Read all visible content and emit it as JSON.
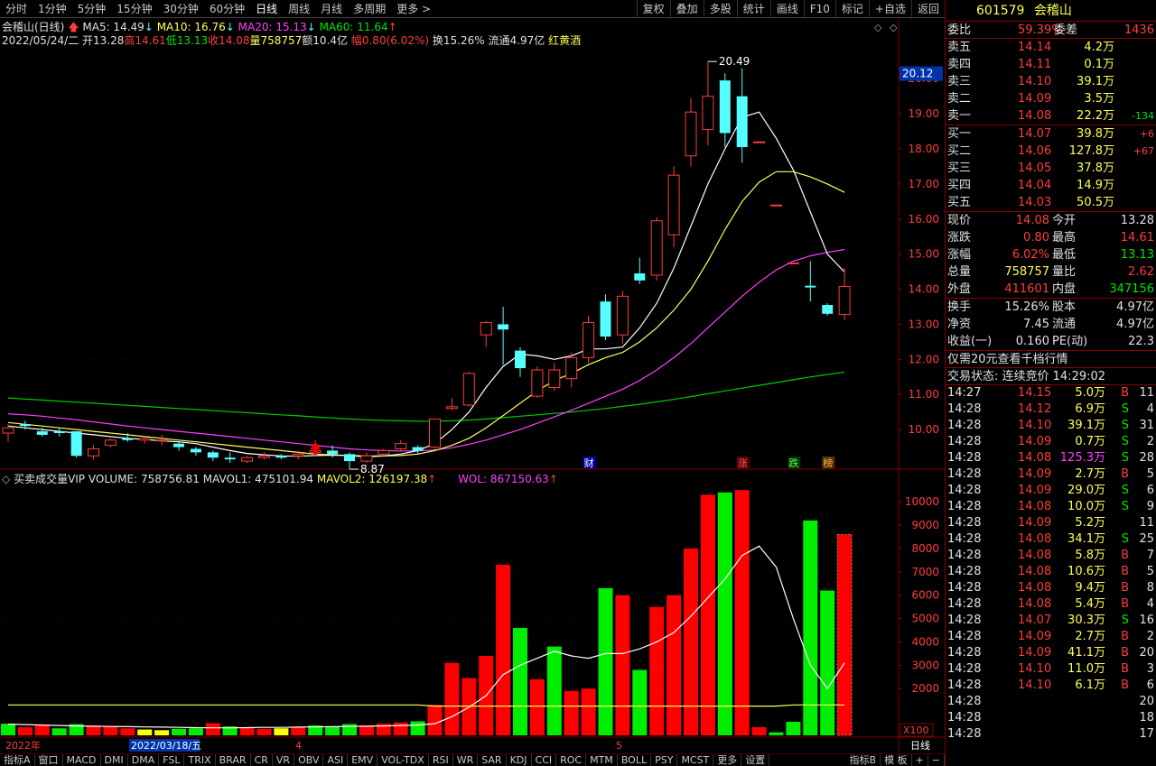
{
  "toolbar": {
    "left": [
      "分时",
      "1分钟",
      "5分钟",
      "15分钟",
      "30分钟",
      "60分钟",
      "日线",
      "周线",
      "月线",
      "多周期",
      "更多 >"
    ],
    "active_index": 6,
    "right": [
      "复权",
      "叠加",
      "多股",
      "统计",
      "画线",
      "F10",
      "标记",
      "+自选",
      "返回"
    ]
  },
  "info": {
    "title": "会稽山(日线)",
    "ma5": "MA5: 14.49",
    "ma10": "MA10: 16.76",
    "ma20": "MA20: 15.13",
    "ma60": "MA60: 11.64",
    "date": "2022/05/24/二",
    "open": "开13.28",
    "high": "高14.61",
    "low": "低13.13",
    "close": "收14.08",
    "volume": "量758757",
    "amount": "额10.4亿",
    "amp": "幅0.80(6.02%)",
    "turnover": "换15.26%",
    "float": "流通4.97亿",
    "concept": "红黄酒"
  },
  "price_axis": {
    "labels": [
      "20.00",
      "19.00",
      "18.00",
      "17.00",
      "16.00",
      "15.00",
      "14.00",
      "13.00",
      "12.00",
      "11.00",
      "10.00"
    ],
    "current": "20.12"
  },
  "annotations": {
    "high": "20.49",
    "low": "8.87",
    "cai": "财",
    "zhang": "涨",
    "die": "跌",
    "bang": "榜"
  },
  "vol_info": {
    "name": "买卖成交量VIP",
    "volume": "VOLUME: 758756.81",
    "mavol1": "MAVOL1: 475101.94",
    "mavol2": "MAVOL2: 126197.38",
    "wol": "WOL: 867150.63"
  },
  "vol_axis": {
    "labels": [
      "10000",
      "9000",
      "8000",
      "7000",
      "6000",
      "5000",
      "4000",
      "3000",
      "2000"
    ],
    "unit": "X100"
  },
  "time_axis": {
    "year": "2022年",
    "date": "2022/03/18/五",
    "m4": "4",
    "m5": "5",
    "right": "日线"
  },
  "bottom_tabs": [
    "指标A",
    "窗口",
    "MACD",
    "DMI",
    "DMA",
    "FSL",
    "TRIX",
    "BRAR",
    "CR",
    "VR",
    "OBV",
    "ASI",
    "EMV",
    "VOL-TDX",
    "RSI",
    "WR",
    "SAR",
    "KDJ",
    "CCI",
    "ROC",
    "MTM",
    "BOLL",
    "PSY",
    "MCST",
    "更多",
    "设置"
  ],
  "bottom_tabs_right": [
    "指标B",
    "模 板",
    "+",
    "−"
  ],
  "quote": {
    "code": "601579",
    "name": "会稽山",
    "weibi_label": "委比",
    "weibi": "59.39%",
    "weicha_label": "委差",
    "weicha": "1436",
    "asks": [
      {
        "label": "卖五",
        "price": "14.14",
        "vol": "4.2万",
        "chg": ""
      },
      {
        "label": "卖四",
        "price": "14.11",
        "vol": "0.1万",
        "chg": ""
      },
      {
        "label": "卖三",
        "price": "14.10",
        "vol": "39.1万",
        "chg": ""
      },
      {
        "label": "卖二",
        "price": "14.09",
        "vol": "3.5万",
        "chg": ""
      },
      {
        "label": "卖一",
        "price": "14.08",
        "vol": "22.2万",
        "chg": "-134"
      }
    ],
    "bids": [
      {
        "label": "买一",
        "price": "14.07",
        "vol": "39.8万",
        "chg": "+6"
      },
      {
        "label": "买二",
        "price": "14.06",
        "vol": "127.8万",
        "chg": "+67"
      },
      {
        "label": "买三",
        "price": "14.05",
        "vol": "37.8万",
        "chg": ""
      },
      {
        "label": "买四",
        "price": "14.04",
        "vol": "14.9万",
        "chg": ""
      },
      {
        "label": "买五",
        "price": "14.03",
        "vol": "50.5万",
        "chg": ""
      }
    ],
    "stats": [
      {
        "l1": "现价",
        "v1": "14.08",
        "c1": "red",
        "l2": "今开",
        "v2": "13.28",
        "c2": "white"
      },
      {
        "l1": "涨跌",
        "v1": "0.80",
        "c1": "red",
        "l2": "最高",
        "v2": "14.61",
        "c2": "red"
      },
      {
        "l1": "涨幅",
        "v1": "6.02%",
        "c1": "red",
        "l2": "最低",
        "v2": "13.13",
        "c2": "green"
      },
      {
        "l1": "总量",
        "v1": "758757",
        "c1": "yellow",
        "l2": "量比",
        "v2": "2.62",
        "c2": "red"
      },
      {
        "l1": "外盘",
        "v1": "411601",
        "c1": "red",
        "l2": "内盘",
        "v2": "347156",
        "c2": "green"
      }
    ],
    "stats2": [
      {
        "l1": "换手",
        "v1": "15.26%",
        "l2": "股本",
        "v2": "4.97亿"
      },
      {
        "l1": "净资",
        "v1": "7.45",
        "l2": "流通",
        "v2": "4.97亿"
      },
      {
        "l1": "收益(一)",
        "v1": "0.160",
        "l2": "PE(动)",
        "v2": "22.3"
      }
    ],
    "promo": "仅需20元查看千档行情",
    "status": "交易状态: 连续竞价 14:29:02"
  },
  "trades": [
    {
      "t": "14:27",
      "p": "14.15",
      "v": "5.0万",
      "s": "B",
      "n": "11",
      "pc": "red",
      "vc": "yellow"
    },
    {
      "t": "14:28",
      "p": "14.12",
      "v": "6.9万",
      "s": "S",
      "n": "4",
      "pc": "red",
      "vc": "yellow"
    },
    {
      "t": "14:28",
      "p": "14.10",
      "v": "39.1万",
      "s": "S",
      "n": "31",
      "pc": "red",
      "vc": "yellow"
    },
    {
      "t": "14:28",
      "p": "14.09",
      "v": "0.7万",
      "s": "S",
      "n": "2",
      "pc": "red",
      "vc": "yellow"
    },
    {
      "t": "14:28",
      "p": "14.08",
      "v": "125.3万",
      "s": "S",
      "n": "28",
      "pc": "red",
      "vc": "magenta"
    },
    {
      "t": "14:28",
      "p": "14.09",
      "v": "2.7万",
      "s": "B",
      "n": "5",
      "pc": "red",
      "vc": "yellow"
    },
    {
      "t": "14:28",
      "p": "14.09",
      "v": "29.0万",
      "s": "S",
      "n": "6",
      "pc": "red",
      "vc": "yellow"
    },
    {
      "t": "14:28",
      "p": "14.08",
      "v": "10.0万",
      "s": "S",
      "n": "9",
      "pc": "red",
      "vc": "yellow"
    },
    {
      "t": "14:28",
      "p": "14.09",
      "v": "5.2万",
      "s": "",
      "n": "11",
      "pc": "red",
      "vc": "yellow"
    },
    {
      "t": "14:28",
      "p": "14.08",
      "v": "34.1万",
      "s": "S",
      "n": "25",
      "pc": "red",
      "vc": "yellow"
    },
    {
      "t": "14:28",
      "p": "14.08",
      "v": "5.8万",
      "s": "B",
      "n": "7",
      "pc": "red",
      "vc": "yellow"
    },
    {
      "t": "14:28",
      "p": "14.08",
      "v": "10.6万",
      "s": "B",
      "n": "5",
      "pc": "red",
      "vc": "yellow"
    },
    {
      "t": "14:28",
      "p": "14.08",
      "v": "9.4万",
      "s": "B",
      "n": "8",
      "pc": "red",
      "vc": "yellow"
    },
    {
      "t": "14:28",
      "p": "14.08",
      "v": "5.4万",
      "s": "B",
      "n": "4",
      "pc": "red",
      "vc": "yellow"
    },
    {
      "t": "14:28",
      "p": "14.07",
      "v": "30.3万",
      "s": "S",
      "n": "16",
      "pc": "red",
      "vc": "yellow"
    },
    {
      "t": "14:28",
      "p": "14.09",
      "v": "2.7万",
      "s": "B",
      "n": "2",
      "pc": "red",
      "vc": "yellow"
    },
    {
      "t": "14:28",
      "p": "14.09",
      "v": "41.1万",
      "s": "B",
      "n": "20",
      "pc": "red",
      "vc": "yellow"
    },
    {
      "t": "14:28",
      "p": "14.10",
      "v": "11.0万",
      "s": "B",
      "n": "3",
      "pc": "red",
      "vc": "yellow"
    },
    {
      "t": "14:28",
      "p": "14.10",
      "v": "6.1万",
      "s": "B",
      "n": "6",
      "pc": "red",
      "vc": "yellow"
    },
    {
      "t": "14:28",
      "p": "",
      "v": "",
      "s": "",
      "n": "20",
      "pc": "red",
      "vc": "yellow"
    },
    {
      "t": "14:28",
      "p": "",
      "v": "",
      "s": "",
      "n": "18",
      "pc": "red",
      "vc": "yellow"
    },
    {
      "t": "14:28",
      "p": "",
      "v": "",
      "s": "",
      "n": "17",
      "pc": "red",
      "vc": "yellow"
    }
  ],
  "chart_data": {
    "type": "candlestick",
    "price_ylim": [
      9.0,
      20.7
    ],
    "vol_ylim": [
      0,
      10700
    ],
    "candles": [
      {
        "o": 9.9,
        "c": 10.05,
        "h": 10.15,
        "l": 9.65,
        "v": 500,
        "col": "g"
      },
      {
        "o": 10.15,
        "c": 10.1,
        "h": 10.25,
        "l": 10.0,
        "v": 350,
        "col": "r"
      },
      {
        "o": 9.95,
        "c": 9.85,
        "h": 10.05,
        "l": 9.8,
        "v": 450,
        "col": "r"
      },
      {
        "o": 9.95,
        "c": 9.9,
        "h": 10.05,
        "l": 9.8,
        "v": 300,
        "col": "g"
      },
      {
        "o": 9.95,
        "c": 9.25,
        "h": 9.95,
        "l": 9.2,
        "v": 480,
        "col": "g"
      },
      {
        "o": 9.25,
        "c": 9.45,
        "h": 9.55,
        "l": 9.15,
        "v": 420,
        "col": "r"
      },
      {
        "o": 9.55,
        "c": 9.7,
        "h": 9.75,
        "l": 9.5,
        "v": 380,
        "col": "r"
      },
      {
        "o": 9.75,
        "c": 9.7,
        "h": 9.9,
        "l": 9.65,
        "v": 300,
        "col": "r"
      },
      {
        "o": 9.7,
        "c": 9.75,
        "h": 9.8,
        "l": 9.6,
        "v": 250,
        "col": "y"
      },
      {
        "o": 9.7,
        "c": 9.7,
        "h": 9.85,
        "l": 9.55,
        "v": 220,
        "col": "y"
      },
      {
        "o": 9.6,
        "c": 9.5,
        "h": 9.65,
        "l": 9.4,
        "v": 280,
        "col": "g"
      },
      {
        "o": 9.45,
        "c": 9.35,
        "h": 9.5,
        "l": 9.25,
        "v": 300,
        "col": "g"
      },
      {
        "o": 9.35,
        "c": 9.2,
        "h": 9.4,
        "l": 9.1,
        "v": 520,
        "col": "r"
      },
      {
        "o": 9.2,
        "c": 9.15,
        "h": 9.35,
        "l": 9.05,
        "v": 380,
        "col": "g"
      },
      {
        "o": 9.1,
        "c": 9.2,
        "h": 9.25,
        "l": 9.05,
        "v": 320,
        "col": "r"
      },
      {
        "o": 9.2,
        "c": 9.25,
        "h": 9.35,
        "l": 9.15,
        "v": 280,
        "col": "r"
      },
      {
        "o": 9.25,
        "c": 9.2,
        "h": 9.3,
        "l": 9.15,
        "v": 300,
        "col": "y"
      },
      {
        "o": 9.25,
        "c": 9.3,
        "h": 9.4,
        "l": 9.15,
        "v": 350,
        "col": "r"
      },
      {
        "o": 9.35,
        "c": 9.4,
        "h": 9.7,
        "l": 9.25,
        "v": 420,
        "col": "g"
      },
      {
        "o": 9.4,
        "c": 9.3,
        "h": 9.55,
        "l": 9.2,
        "v": 380,
        "col": "g"
      },
      {
        "o": 9.3,
        "c": 9.1,
        "h": 9.35,
        "l": 8.87,
        "v": 480,
        "col": "g"
      },
      {
        "o": 9.1,
        "c": 9.25,
        "h": 9.35,
        "l": 9.05,
        "v": 420,
        "col": "r"
      },
      {
        "o": 9.3,
        "c": 9.4,
        "h": 9.45,
        "l": 9.25,
        "v": 500,
        "col": "r"
      },
      {
        "o": 9.45,
        "c": 9.6,
        "h": 9.7,
        "l": 9.4,
        "v": 550,
        "col": "r"
      },
      {
        "o": 9.5,
        "c": 9.4,
        "h": 9.55,
        "l": 9.3,
        "v": 600,
        "col": "g"
      },
      {
        "o": 9.5,
        "c": 10.3,
        "h": 10.3,
        "l": 9.45,
        "v": 1300,
        "col": "r"
      },
      {
        "o": 10.6,
        "c": 10.65,
        "h": 10.9,
        "l": 10.55,
        "v": 3100,
        "col": "r"
      },
      {
        "o": 10.7,
        "c": 11.6,
        "h": 11.65,
        "l": 10.65,
        "v": 2450,
        "col": "r"
      },
      {
        "o": 12.7,
        "c": 13.05,
        "h": 13.1,
        "l": 12.35,
        "v": 3400,
        "col": "r"
      },
      {
        "o": 13.0,
        "c": 12.85,
        "h": 13.5,
        "l": 11.85,
        "v": 7300,
        "col": "r"
      },
      {
        "o": 12.25,
        "c": 11.75,
        "h": 12.35,
        "l": 11.5,
        "v": 4600,
        "col": "g"
      },
      {
        "o": 10.95,
        "c": 11.7,
        "h": 11.8,
        "l": 10.9,
        "v": 2400,
        "col": "r"
      },
      {
        "o": 11.2,
        "c": 11.7,
        "h": 11.9,
        "l": 11.1,
        "v": 3800,
        "col": "g"
      },
      {
        "o": 11.45,
        "c": 12.05,
        "h": 12.2,
        "l": 11.2,
        "v": 1900,
        "col": "r"
      },
      {
        "o": 12.05,
        "c": 13.05,
        "h": 13.25,
        "l": 11.9,
        "v": 2000,
        "col": "r"
      },
      {
        "o": 13.65,
        "c": 12.65,
        "h": 13.85,
        "l": 12.55,
        "v": 6300,
        "col": "g"
      },
      {
        "o": 12.7,
        "c": 13.8,
        "h": 13.95,
        "l": 12.45,
        "v": 6000,
        "col": "r"
      },
      {
        "o": 14.45,
        "c": 14.25,
        "h": 14.9,
        "l": 14.15,
        "v": 2800,
        "col": "g"
      },
      {
        "o": 14.4,
        "c": 15.95,
        "h": 16.05,
        "l": 14.25,
        "v": 5500,
        "col": "r"
      },
      {
        "o": 15.55,
        "c": 17.25,
        "h": 17.5,
        "l": 15.2,
        "v": 6000,
        "col": "r"
      },
      {
        "o": 17.8,
        "c": 19.05,
        "h": 19.45,
        "l": 17.5,
        "v": 8000,
        "col": "r"
      },
      {
        "o": 18.55,
        "c": 19.5,
        "h": 20.49,
        "l": 18.1,
        "v": 10300,
        "col": "r"
      },
      {
        "o": 19.95,
        "c": 18.45,
        "h": 20.15,
        "l": 18.05,
        "v": 10400,
        "col": "g"
      },
      {
        "o": 19.5,
        "c": 18.05,
        "h": 20.3,
        "l": 17.6,
        "v": 10500,
        "col": "r"
      },
      {
        "o": 18.2,
        "c": 18.2,
        "h": 18.2,
        "l": 18.2,
        "v": 350,
        "col": "r"
      },
      {
        "o": 16.4,
        "c": 16.4,
        "h": 16.4,
        "l": 16.4,
        "v": 130,
        "col": "g"
      },
      {
        "o": 14.75,
        "c": 14.75,
        "h": 14.75,
        "l": 14.75,
        "v": 580,
        "col": "g"
      },
      {
        "o": 14.1,
        "c": 14.05,
        "h": 14.8,
        "l": 13.65,
        "v": 9200,
        "col": "g"
      },
      {
        "o": 13.55,
        "c": 13.3,
        "h": 13.6,
        "l": 13.25,
        "v": 6200,
        "col": "g"
      },
      {
        "o": 13.28,
        "c": 14.08,
        "h": 14.61,
        "l": 13.13,
        "v": 8600,
        "col": "r"
      }
    ],
    "ma5": [
      10.1,
      10.05,
      10.0,
      9.95,
      9.9,
      9.85,
      9.8,
      9.75,
      9.72,
      9.68,
      9.65,
      9.6,
      9.5,
      9.4,
      9.32,
      9.28,
      9.25,
      9.24,
      9.26,
      9.27,
      9.26,
      9.22,
      9.25,
      9.3,
      9.4,
      9.6,
      10.0,
      10.5,
      11.2,
      11.8,
      12.15,
      12.1,
      12.0,
      12.1,
      12.3,
      12.3,
      12.35,
      12.9,
      13.6,
      14.6,
      15.8,
      17.0,
      18.0,
      18.9,
      19.05,
      18.3,
      17.4,
      16.2,
      15.0,
      14.49
    ],
    "ma10": [
      10.2,
      10.15,
      10.1,
      10.05,
      10.0,
      9.95,
      9.9,
      9.85,
      9.8,
      9.75,
      9.7,
      9.65,
      9.6,
      9.55,
      9.5,
      9.45,
      9.4,
      9.35,
      9.3,
      9.28,
      9.26,
      9.25,
      9.25,
      9.26,
      9.3,
      9.4,
      9.55,
      9.75,
      10.05,
      10.4,
      10.75,
      11.1,
      11.4,
      11.6,
      11.85,
      12.05,
      12.2,
      12.5,
      12.9,
      13.4,
      14.0,
      14.8,
      15.7,
      16.5,
      17.05,
      17.35,
      17.35,
      17.2,
      17.0,
      16.76
    ],
    "ma20": [
      10.45,
      10.42,
      10.38,
      10.33,
      10.28,
      10.22,
      10.16,
      10.1,
      10.05,
      10.0,
      9.95,
      9.9,
      9.85,
      9.8,
      9.75,
      9.7,
      9.65,
      9.6,
      9.55,
      9.5,
      9.45,
      9.42,
      9.4,
      9.39,
      9.39,
      9.42,
      9.48,
      9.58,
      9.7,
      9.85,
      10.0,
      10.18,
      10.36,
      10.55,
      10.75,
      10.95,
      11.15,
      11.4,
      11.7,
      12.05,
      12.45,
      12.9,
      13.35,
      13.8,
      14.2,
      14.55,
      14.8,
      14.95,
      15.05,
      15.13
    ],
    "ma60": [
      10.9,
      10.87,
      10.84,
      10.81,
      10.78,
      10.75,
      10.72,
      10.69,
      10.66,
      10.63,
      10.6,
      10.57,
      10.54,
      10.51,
      10.48,
      10.45,
      10.42,
      10.39,
      10.36,
      10.33,
      10.3,
      10.28,
      10.26,
      10.25,
      10.24,
      10.24,
      10.25,
      10.27,
      10.3,
      10.34,
      10.38,
      10.42,
      10.46,
      10.5,
      10.55,
      10.6,
      10.66,
      10.72,
      10.79,
      10.86,
      10.94,
      11.02,
      11.1,
      11.18,
      11.26,
      11.34,
      11.42,
      11.5,
      11.57,
      11.64
    ],
    "mavol": [
      480,
      460,
      440,
      420,
      400,
      390,
      380,
      370,
      360,
      350,
      340,
      330,
      320,
      320,
      330,
      340,
      340,
      350,
      360,
      370,
      380,
      390,
      400,
      420,
      440,
      500,
      800,
      1200,
      1700,
      2600,
      3000,
      3300,
      3600,
      3400,
      3300,
      3500,
      3500,
      3700,
      4000,
      4400,
      5100,
      5900,
      6700,
      7700,
      8100,
      7200,
      5000,
      3000,
      2000,
      3100
    ]
  }
}
